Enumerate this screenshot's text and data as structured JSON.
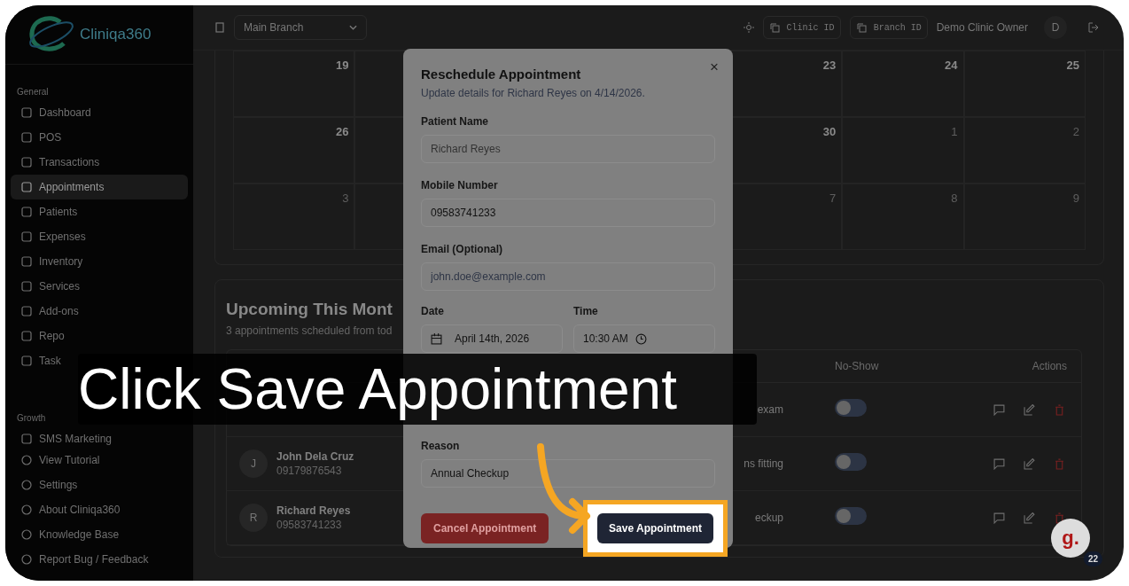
{
  "sidebar": {
    "logo": "Cliniqa360",
    "sections": [
      {
        "title": "General",
        "items": [
          {
            "label": "Dashboard",
            "selected": false
          },
          {
            "label": "POS",
            "selected": false
          },
          {
            "label": "Transactions",
            "selected": false
          },
          {
            "label": "Appointments",
            "selected": true
          },
          {
            "label": "Patients",
            "selected": false
          },
          {
            "label": "Expenses",
            "selected": false
          },
          {
            "label": "Inventory",
            "selected": false
          },
          {
            "label": "Services",
            "selected": false
          },
          {
            "label": "Add-ons",
            "selected": false
          },
          {
            "label": "Repo",
            "selected": false
          },
          {
            "label": "Task",
            "selected": false
          }
        ]
      },
      {
        "title": "Growth",
        "items": [
          {
            "label": "SMS Marketing",
            "selected": false
          }
        ]
      }
    ],
    "footer": [
      "View Tutorial",
      "Settings",
      "About Cliniqa360",
      "Knowledge Base",
      "Report Bug / Feedback"
    ]
  },
  "topbar": {
    "branch": "Main Branch",
    "chips": [
      "Clinic ID",
      "Branch ID"
    ],
    "user": "Demo Clinic Owner",
    "avatar": "D"
  },
  "calendar": {
    "weeks": [
      [
        {
          "day": "19",
          "muted": false
        },
        {
          "day": "23",
          "muted": false
        },
        {
          "day": "24",
          "muted": false
        },
        {
          "day": "25",
          "muted": false
        }
      ],
      [
        {
          "day": "26",
          "muted": false
        },
        {
          "day": "30",
          "muted": false
        },
        {
          "day": "1",
          "muted": true
        },
        {
          "day": "2",
          "muted": true
        }
      ],
      [
        {
          "day": "3",
          "muted": true
        },
        {
          "day": "7",
          "muted": true
        },
        {
          "day": "8",
          "muted": true
        },
        {
          "day": "9",
          "muted": true
        }
      ]
    ]
  },
  "upcoming": {
    "title": "Upcoming This Mont",
    "subtitle": "3 appointments scheduled from tod",
    "columns": [
      "No-Show",
      "Actions"
    ],
    "rows": [
      {
        "reason": "exam",
        "no_show": false
      },
      {
        "initial": "J",
        "name": "John Dela Cruz",
        "phone": "09179876543",
        "reason": "ns fitting",
        "no_show": false
      },
      {
        "initial": "R",
        "name": "Richard Reyes",
        "phone": "09583741233",
        "reason": "eckup",
        "no_show": false
      }
    ]
  },
  "modal": {
    "title": "Reschedule Appointment",
    "subtitle": "Update details for Richard Reyes on 4/14/2026.",
    "close": "×",
    "patient_label": "Patient Name",
    "patient_value": "Richard Reyes",
    "mobile_label": "Mobile Number",
    "mobile_value": "09583741233",
    "email_label": "Email (Optional)",
    "email_placeholder": "john.doe@example.com",
    "date_label": "Date",
    "date_value": "April 14th, 2026",
    "time_label": "Time",
    "time_value": "10:30  AM",
    "reason_label": "Reason",
    "reason_value": "Annual Checkup",
    "cancel": "Cancel Appointment",
    "save": "Save Appointment"
  },
  "caption": "Click Save Appointment",
  "help": {
    "letter": "g.",
    "badge": "22"
  }
}
